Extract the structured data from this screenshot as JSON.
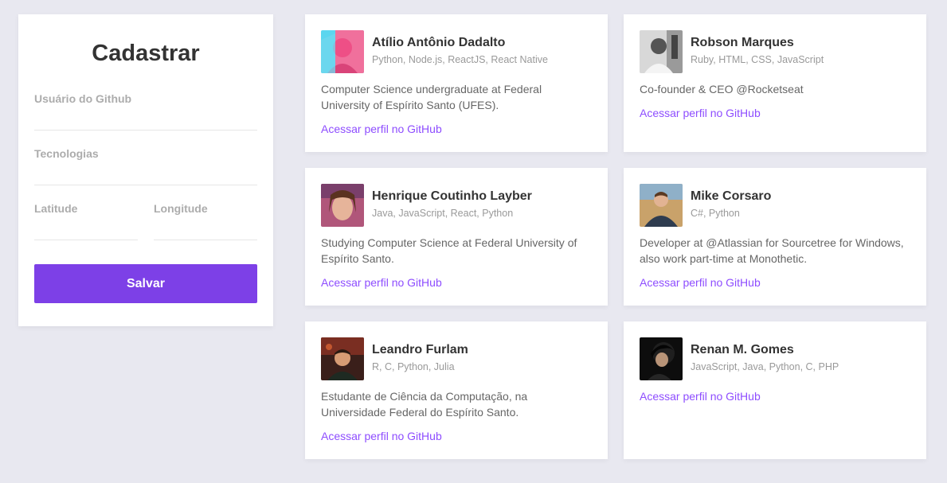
{
  "form": {
    "title": "Cadastrar",
    "github_label": "Usuário do Github",
    "github_value": "",
    "techs_label": "Tecnologias",
    "techs_value": "",
    "latitude_label": "Latitude",
    "latitude_value": "",
    "longitude_label": "Longitude",
    "longitude_value": "",
    "submit_label": "Salvar"
  },
  "devs": [
    {
      "name": "Atílio Antônio Dadalto",
      "techs": "Python, Node.js, ReactJS, React Native",
      "bio": "Computer Science undergraduate at Federal University of Espírito Santo (UFES).",
      "link": "Acessar perfil no GitHub"
    },
    {
      "name": "Robson Marques",
      "techs": "Ruby, HTML, CSS, JavaScript",
      "bio": "Co-founder & CEO @Rocketseat",
      "link": "Acessar perfil no GitHub"
    },
    {
      "name": "Henrique Coutinho Layber",
      "techs": "Java, JavaScript, React, Python",
      "bio": "Studying Computer Science at Federal University of Espírito Santo.",
      "link": "Acessar perfil no GitHub"
    },
    {
      "name": "Mike Corsaro",
      "techs": "C#, Python",
      "bio": "Developer at @Atlassian for Sourcetree for Windows, also work part-time at Monothetic.",
      "link": "Acessar perfil no GitHub"
    },
    {
      "name": "Leandro Furlam",
      "techs": "R, C, Python, Julia",
      "bio": "Estudante de Ciência da Computação, na Universidade Federal do Espírito Santo.",
      "link": "Acessar perfil no GitHub"
    },
    {
      "name": "Renan M. Gomes",
      "techs": "JavaScript, Java, Python, C, PHP",
      "bio": "",
      "link": "Acessar perfil no GitHub"
    }
  ],
  "colors": {
    "background": "#e8e8f0",
    "accent": "#7d40e7",
    "link": "#8e4dff"
  }
}
